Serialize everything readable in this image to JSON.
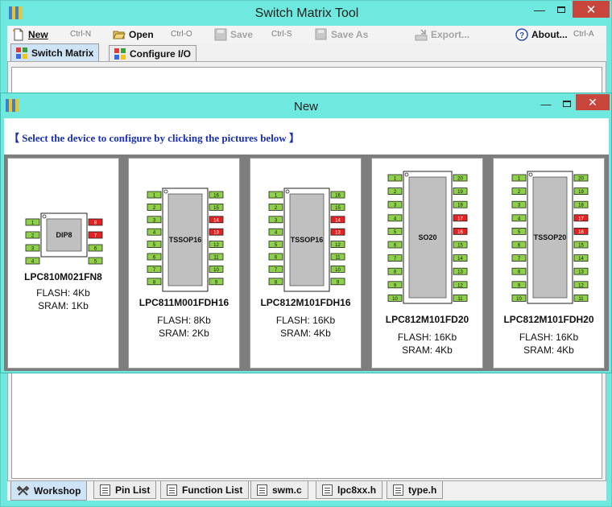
{
  "window": {
    "title": "Switch Matrix Tool",
    "controls": {
      "minimize": "—",
      "maximize": "□",
      "close": "✕"
    }
  },
  "toolbar": {
    "new": {
      "label": "New",
      "shortcut": "Ctrl-N"
    },
    "open": {
      "label": "Open",
      "shortcut": "Ctrl-O"
    },
    "save": {
      "label": "Save",
      "shortcut": "Ctrl-S"
    },
    "save_as": {
      "label": "Save As"
    },
    "export": {
      "label": "Export..."
    },
    "about": {
      "label": "About...",
      "shortcut": "Ctrl-A"
    }
  },
  "tabs": [
    {
      "label": "Switch Matrix",
      "active": true
    },
    {
      "label": "Configure I/O",
      "active": false
    }
  ],
  "bottom_tabs": [
    {
      "label": "Workshop",
      "active": true
    },
    {
      "label": "Pin List",
      "active": false
    },
    {
      "label": "Function List",
      "active": false
    },
    {
      "label": "swm.c",
      "active": false
    },
    {
      "label": "lpc8xx.h",
      "active": false
    },
    {
      "label": "type.h",
      "active": false
    }
  ],
  "dialog": {
    "title": "New",
    "instruction": "【 Select the device to configure by clicking the pictures below 】",
    "devices": [
      {
        "package": "DIP8",
        "pins": 8,
        "part": "LPC810M021FN8",
        "flash": "FLASH: 4Kb",
        "sram": "SRAM: 1Kb",
        "pin_labels": [
          "1",
          "2",
          "3",
          "4",
          "5",
          "6",
          "7",
          "8"
        ]
      },
      {
        "package": "TSSOP16",
        "pins": 16,
        "part": "LPC811M001FDH16",
        "flash": "FLASH: 8Kb",
        "sram": "SRAM: 2Kb",
        "pin_labels": [
          "1",
          "2",
          "3",
          "4",
          "5",
          "6",
          "7",
          "8",
          "9",
          "10",
          "11",
          "12",
          "13",
          "14",
          "15",
          "16"
        ]
      },
      {
        "package": "TSSOP16",
        "pins": 16,
        "part": "LPC812M101FDH16",
        "flash": "FLASH: 16Kb",
        "sram": "SRAM: 4Kb",
        "pin_labels": [
          "1",
          "2",
          "3",
          "4",
          "5",
          "6",
          "7",
          "8",
          "9",
          "10",
          "11",
          "12",
          "13",
          "14",
          "15",
          "16"
        ]
      },
      {
        "package": "SO20",
        "pins": 20,
        "part": "LPC812M101FD20",
        "flash": "FLASH: 16Kb",
        "sram": "SRAM: 4Kb",
        "pin_labels": [
          "1",
          "2",
          "3",
          "4",
          "5",
          "6",
          "7",
          "8",
          "9",
          "10",
          "11",
          "12",
          "13",
          "14",
          "15",
          "16",
          "17",
          "18",
          "19",
          "20"
        ]
      },
      {
        "package": "TSSOP20",
        "pins": 20,
        "part": "LPC812M101FDH20",
        "flash": "FLASH: 16Kb",
        "sram": "SRAM: 4Kb",
        "pin_labels": [
          "1",
          "2",
          "3",
          "4",
          "5",
          "6",
          "7",
          "8",
          "9",
          "10",
          "11",
          "12",
          "13",
          "14",
          "15",
          "16",
          "17",
          "18",
          "19",
          "20"
        ]
      }
    ]
  },
  "colors": {
    "window_frame": "#6fe9df",
    "active_tab": "#cfe3f7",
    "pin_normal": "#8fd04a",
    "pin_special": "#e52222",
    "chip_body": "#c0c0c0",
    "instruction_text": "#1a2fb3",
    "close_button": "#c9463d"
  }
}
